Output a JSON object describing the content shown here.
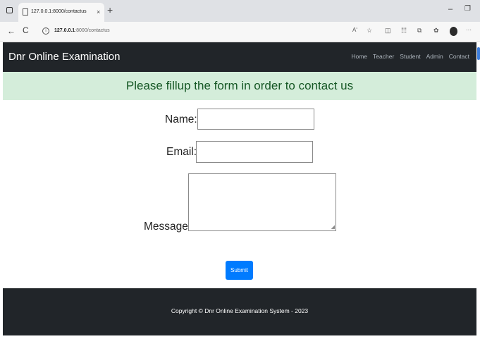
{
  "browser": {
    "tab_title": "127.0.0.1:8000/contactus",
    "tab_close": "×",
    "new_tab": "+",
    "minimize": "–",
    "restore": "❐",
    "back": "←",
    "reload": "C",
    "url_host": "127.0.0.1",
    "url_rest": ":8000/contactus",
    "read_aloud": "Aʹ",
    "toolbar_icons": [
      "favorites-icon",
      "split-screen-icon",
      "collections-icon",
      "extensions-icon",
      "copilot-icon",
      "profile-avatar",
      "more-icon"
    ],
    "more": "···"
  },
  "navbar": {
    "brand": "Dnr Online Examination",
    "links": [
      "Home",
      "Teacher",
      "Student",
      "Admin",
      "Contact"
    ]
  },
  "banner": {
    "text": "Please fillup the form in order to contact us"
  },
  "form": {
    "name_label": "Name:",
    "email_label": "Email:",
    "message_label": "Message:",
    "name_value": "",
    "email_value": "",
    "message_value": "",
    "submit_label": "Submit"
  },
  "footer": {
    "copyright": "Copyright © Dnr Online Examination System - 2023"
  },
  "colors": {
    "navbar_bg": "#212529",
    "banner_bg": "#d4edda",
    "banner_text": "#155724",
    "submit_bg": "#007bff"
  }
}
